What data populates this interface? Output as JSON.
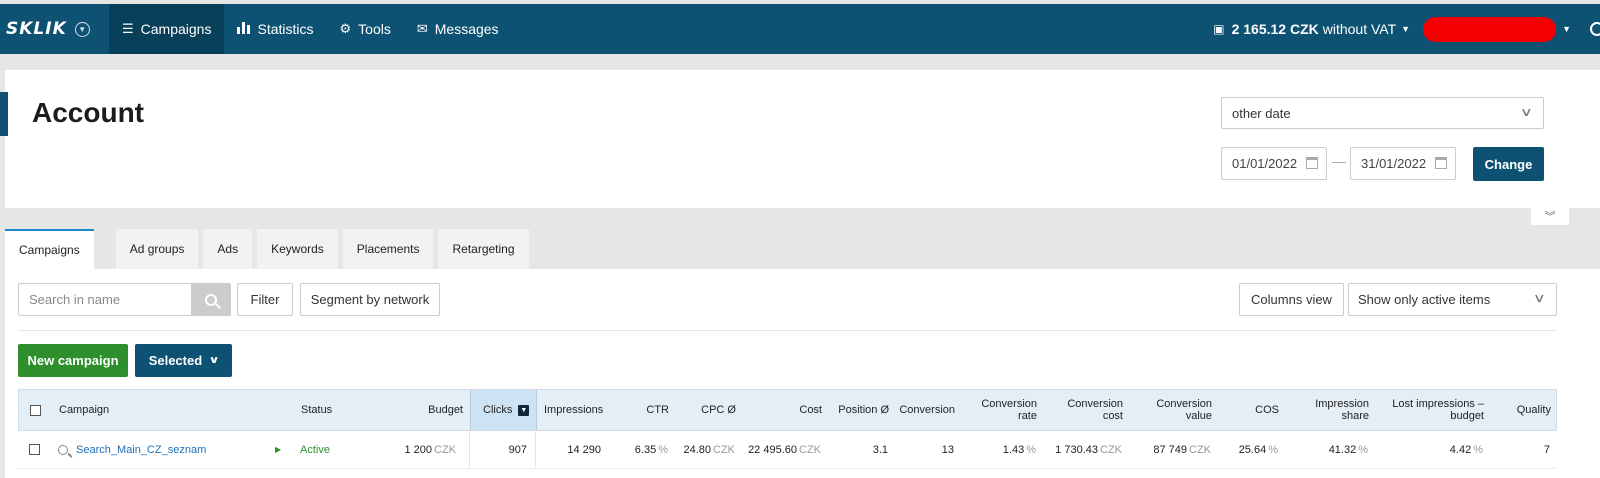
{
  "app": {
    "logo": "SKLIK"
  },
  "nav": {
    "items": [
      {
        "label": "Campaigns",
        "icon": "list-icon",
        "active": true
      },
      {
        "label": "Statistics",
        "icon": "bar-chart-icon",
        "active": false
      },
      {
        "label": "Tools",
        "icon": "gear-icon",
        "active": false
      },
      {
        "label": "Messages",
        "icon": "envelope-icon",
        "active": false
      }
    ],
    "credit_amount": "2 165.12 CZK",
    "credit_suffix": "without VAT"
  },
  "header": {
    "title": "Account",
    "date_select": "other date",
    "date_from": "01/01/2022",
    "date_to": "31/01/2022",
    "date_separator": "—",
    "change_label": "Change"
  },
  "tabs": [
    "Campaigns",
    "Ad groups",
    "Ads",
    "Keywords",
    "Placements",
    "Retargeting"
  ],
  "toolbar": {
    "search_placeholder": "Search in name",
    "filter_label": "Filter",
    "segment_label": "Segment by network",
    "columns_view_label": "Columns view",
    "active_select": "Show only active items",
    "new_campaign_label": "New campaign",
    "selected_label": "Selected"
  },
  "table": {
    "headers": {
      "campaign": "Campaign",
      "status": "Status",
      "budget": "Budget",
      "clicks": "Clicks",
      "impressions": "Impressions",
      "ctr": "CTR",
      "cpc": "CPC Ø",
      "cost": "Cost",
      "position": "Position Ø",
      "conversion": "Conversion",
      "conversion_rate_1": "Conversion",
      "conversion_rate_2": "rate",
      "conversion_cost_1": "Conversion",
      "conversion_cost_2": "cost",
      "conversion_value_1": "Conversion",
      "conversion_value_2": "value",
      "cos": "COS",
      "impression_share_1": "Impression",
      "impression_share_2": "share",
      "lost_impressions_1": "Lost impressions –",
      "lost_impressions_2": "budget",
      "quality": "Quality"
    },
    "rows": [
      {
        "campaign": "Search_Main_CZ_seznam",
        "status": "Active",
        "budget": "1 200",
        "budget_unit": "CZK",
        "clicks": "907",
        "impressions": "14 290",
        "ctr": "6.35",
        "ctr_unit": "%",
        "cpc": "24.80",
        "cpc_unit": "CZK",
        "cost": "22 495.60",
        "cost_unit": "CZK",
        "position": "3.1",
        "conversion": "13",
        "conversion_rate": "1.43",
        "conversion_rate_unit": "%",
        "conversion_cost": "1 730.43",
        "conversion_cost_unit": "CZK",
        "conversion_value": "87 749",
        "conversion_value_unit": "CZK",
        "cos": "25.64",
        "cos_unit": "%",
        "impression_share": "41.32",
        "impression_share_unit": "%",
        "lost_impressions": "4.42",
        "lost_impressions_unit": "%",
        "quality": "7"
      }
    ]
  },
  "colors": {
    "primary": "#0d5272",
    "primary_dark": "#083f59",
    "success": "#2e8f2c",
    "link": "#1d6fb8",
    "redacted": "#f50000",
    "tab_accent": "#1d86c8"
  }
}
